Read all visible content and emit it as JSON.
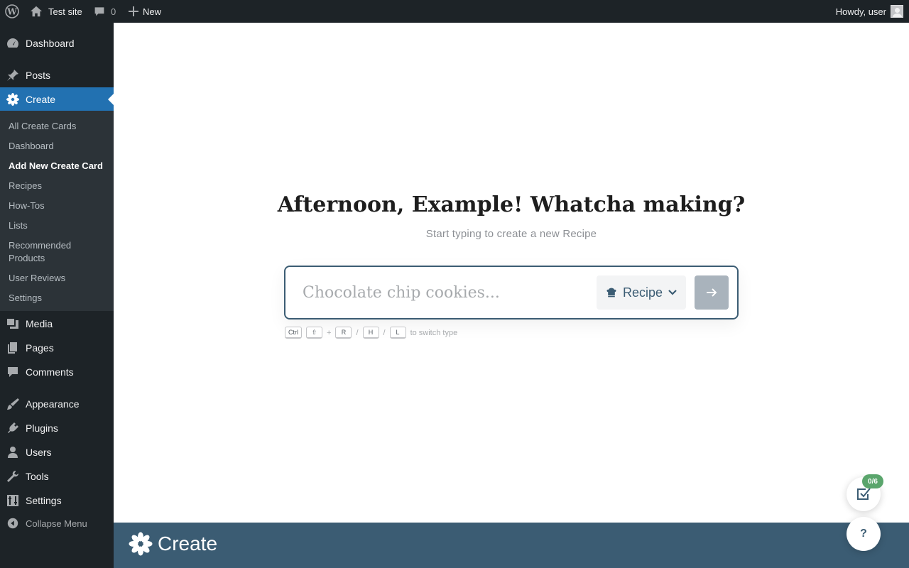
{
  "admin_bar": {
    "site_name": "Test site",
    "comments_count": "0",
    "new_label": "New",
    "howdy": "Howdy, user"
  },
  "sidebar": {
    "menu": [
      {
        "label": "Dashboard",
        "icon": "dashboard-icon"
      },
      {
        "label": "Posts",
        "icon": "pin-icon"
      },
      {
        "label": "Create",
        "icon": "flower-icon",
        "current": true
      },
      {
        "label": "Media",
        "icon": "media-icon"
      },
      {
        "label": "Pages",
        "icon": "pages-icon"
      },
      {
        "label": "Comments",
        "icon": "comment-icon"
      },
      {
        "label": "Appearance",
        "icon": "brush-icon"
      },
      {
        "label": "Plugins",
        "icon": "plug-icon"
      },
      {
        "label": "Users",
        "icon": "user-icon"
      },
      {
        "label": "Tools",
        "icon": "wrench-icon"
      },
      {
        "label": "Settings",
        "icon": "sliders-icon"
      }
    ],
    "submenu": [
      "All Create Cards",
      "Dashboard",
      "Add New Create Card",
      "Recipes",
      "How-Tos",
      "Lists",
      "Recommended Products",
      "User Reviews",
      "Settings"
    ],
    "submenu_active": "Add New Create Card",
    "collapse_label": "Collapse Menu"
  },
  "main": {
    "greeting": "Afternoon, Example! Whatcha making?",
    "subtitle": "Start typing to create a new Recipe",
    "search_placeholder": "Chocolate chip cookies...",
    "type_label": "Recipe",
    "shortcuts": {
      "ctrl": "Ctrl",
      "shift": "⇧",
      "plus": "+",
      "r": "R",
      "h": "H",
      "l": "L",
      "slash": "/",
      "hint": "to switch type"
    }
  },
  "footer": {
    "brand": "Create"
  },
  "floating": {
    "tasks_badge": "0/6",
    "help_label": "?"
  },
  "colors": {
    "admin_dark": "#1d2327",
    "submenu_bg": "#2c3338",
    "current_blue": "#2271b1",
    "brand_navy": "#3b5c73",
    "badge_green": "#5aa56c"
  }
}
